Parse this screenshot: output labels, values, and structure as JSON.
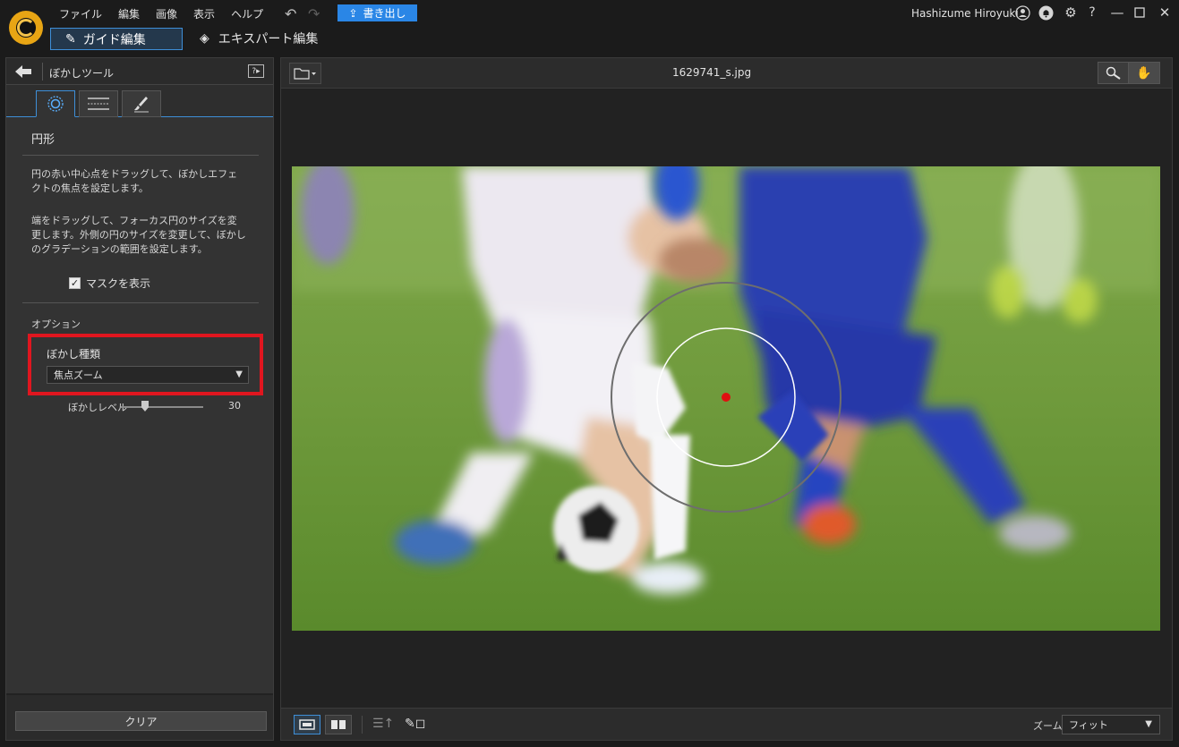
{
  "menu": {
    "items": [
      "ファイル",
      "編集",
      "画像",
      "表示",
      "ヘルプ"
    ],
    "export_label": "書き出し",
    "user_name": "Hashizume Hiroyuki"
  },
  "modes": {
    "guide_label": "ガイド編集",
    "expert_label": "エキスパート編集"
  },
  "left_panel": {
    "title": "ぼかしツール",
    "shape_name": "円形",
    "desc1": "円の赤い中心点をドラッグして、ぼかしエフェクトの焦点を設定します。",
    "desc2": "端をドラッグして、フォーカス円のサイズを変更します。外側の円のサイズを変更して、ぼかしのグラデーションの範囲を設定します。",
    "show_mask_label": "マスクを表示",
    "show_mask_checked": true,
    "options_title": "オプション",
    "blur_type_label": "ぼかし種類",
    "blur_type_value": "焦点ズーム",
    "blur_level_label": "ぼかしレベル",
    "blur_level_value": "30",
    "clear_label": "クリア"
  },
  "main": {
    "filename": "1629741_s.jpg",
    "zoom_label": "ズーム:",
    "zoom_value": "フィット"
  },
  "colors": {
    "accent": "#2a86e6",
    "highlight": "#e0161f"
  }
}
